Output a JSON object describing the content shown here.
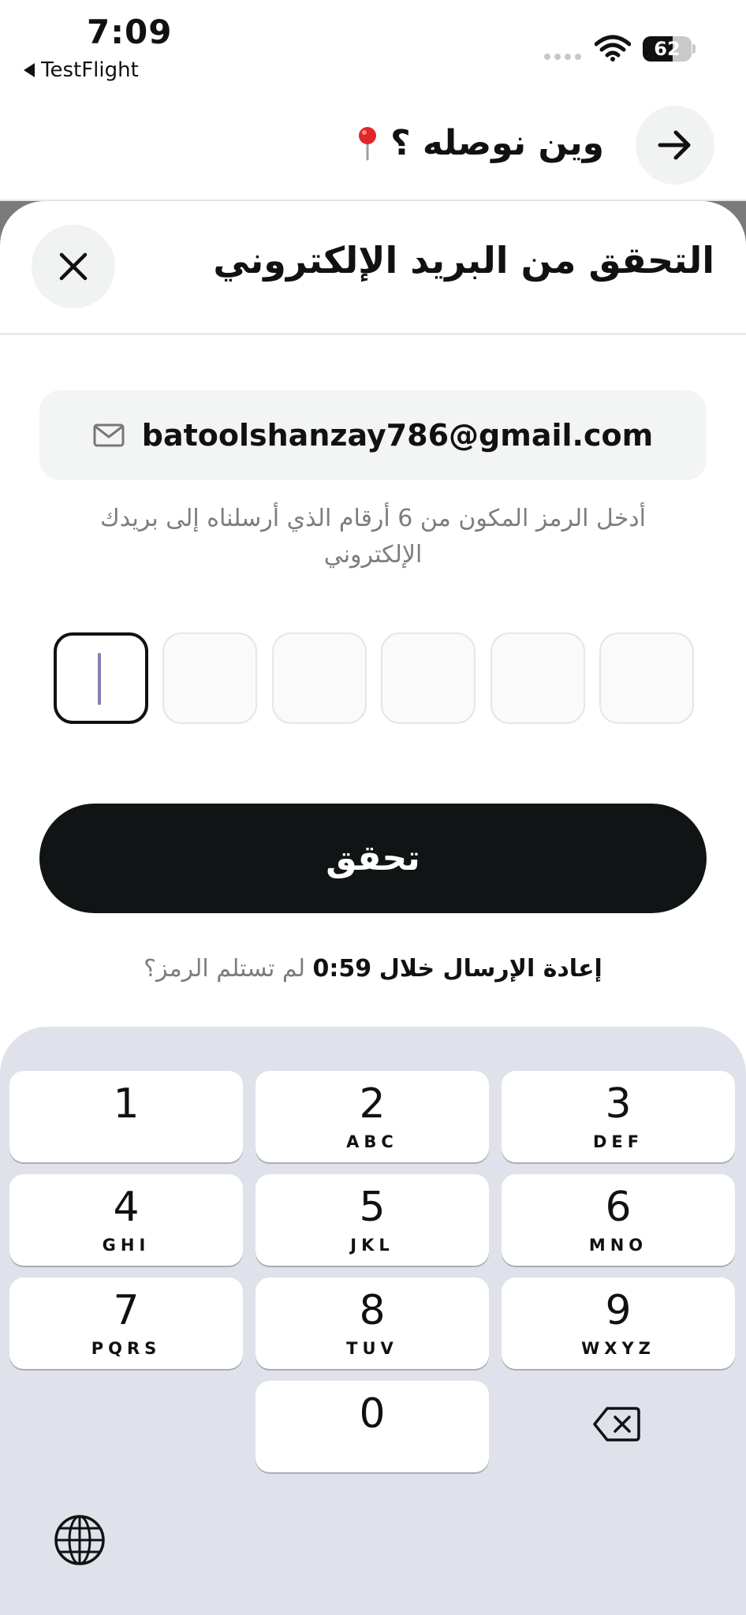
{
  "status_bar": {
    "time": "7:09",
    "back_app": "TestFlight",
    "battery_percent": "62",
    "battery_level": 0.62
  },
  "page_header": {
    "title": "وين نوصله ؟",
    "pin_icon": "pin-icon",
    "forward_icon": "arrow-right-icon"
  },
  "sheet": {
    "title": "التحقق من البريد الإلكتروني",
    "close_icon": "close-icon",
    "email": "batoolshanzay786@gmail.com",
    "mail_icon": "mail-icon",
    "instruction": "أدخل الرمز المكون من 6 أرقام الذي أرسلناه إلى بريدك الإلكتروني",
    "otp_boxes": [
      "",
      "",
      "",
      "",
      "",
      ""
    ],
    "active_box": 0,
    "verify_label": "تحقق",
    "resend_question": "لم تستلم الرمز؟",
    "resend_prefix": "إعادة الإرسال خلال",
    "resend_timer": "0:59"
  },
  "keyboard": {
    "keys": [
      {
        "digit": "1",
        "letters": ""
      },
      {
        "digit": "2",
        "letters": "ABC"
      },
      {
        "digit": "3",
        "letters": "DEF"
      },
      {
        "digit": "4",
        "letters": "GHI"
      },
      {
        "digit": "5",
        "letters": "JKL"
      },
      {
        "digit": "6",
        "letters": "MNO"
      },
      {
        "digit": "7",
        "letters": "PQRS"
      },
      {
        "digit": "8",
        "letters": "TUV"
      },
      {
        "digit": "9",
        "letters": "WXYZ"
      },
      {
        "digit": "0",
        "letters": ""
      }
    ],
    "backspace_icon": "backspace-icon",
    "globe_icon": "globe-icon"
  }
}
